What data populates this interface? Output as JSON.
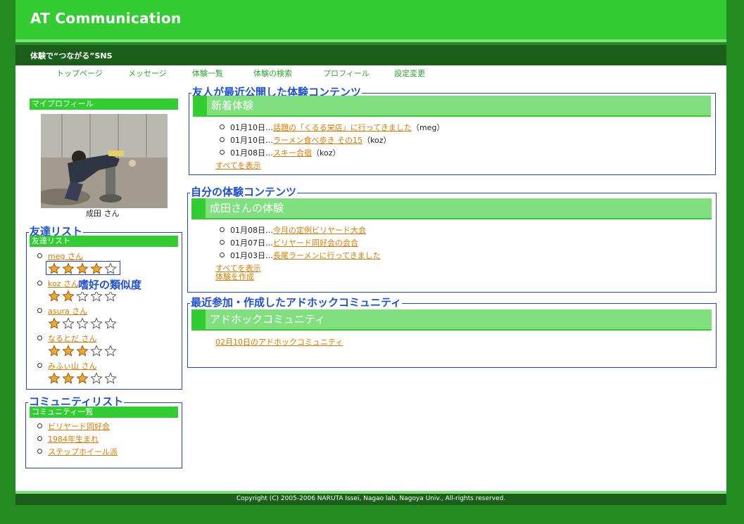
{
  "header": {
    "title": "AT Communication",
    "tagline": "体験で“つながる”SNS"
  },
  "nav": [
    "トップページ",
    "メッセージ",
    "体験一覧",
    "体験の検索",
    "プロフィール",
    "設定変更"
  ],
  "sidebar": {
    "profile": {
      "bar": "マイプロフィール",
      "name": "成田 さん"
    },
    "friends": {
      "legend": "友達リスト",
      "bar": "友達リスト",
      "annotation": "嗜好の類似度",
      "items": [
        {
          "name": "meg さん",
          "rating": 4
        },
        {
          "name": "koz さん",
          "rating": 2
        },
        {
          "name": "asura さん",
          "rating": 1
        },
        {
          "name": "なるとだ さん",
          "rating": 3
        },
        {
          "name": "みふぃ山 さん",
          "rating": 3
        }
      ]
    },
    "communities": {
      "legend": "コミュニティリスト",
      "bar": "コミュニティ一覧",
      "items": [
        "ビリヤード同好会",
        "1984年生まれ",
        "ステップホイール派"
      ]
    }
  },
  "friends_recent": {
    "legend": "友人が最近公開した体験コンテンツ",
    "heading": "新着体験",
    "items": [
      {
        "date": "01月10日…",
        "title": "話題の「くるる栄店」に行ってきました",
        "author": "（meg）"
      },
      {
        "date": "01月10日…",
        "title": "ラーメン食べ歩き その15",
        "author": "（koz）"
      },
      {
        "date": "01月08日…",
        "title": "スキー合宿",
        "author": "（koz）"
      }
    ],
    "show_all": "すべてを表示"
  },
  "my_content": {
    "legend": "自分の体験コンテンツ",
    "heading": "成田さんの体験",
    "items": [
      {
        "date": "01月08日…",
        "title": "今月の定例ビリヤード大会"
      },
      {
        "date": "01月07日…",
        "title": "ビリヤード同好会の会合"
      },
      {
        "date": "01月03日…",
        "title": "長尾ラーメンに行ってきました"
      }
    ],
    "show_all": "すべてを表示",
    "create": "体験を作成"
  },
  "adhoc": {
    "legend": "最近参加・作成したアドホックコミュニティ",
    "heading": "アドホックコミュニティ",
    "link": "02月10日のアドホックコミュニティ"
  },
  "footer": {
    "copyright": "Copyright (C) 2005-2006 NARUTA Issei, Nagao lab, Nagoya Univ., All-rights reserved."
  },
  "colors": {
    "header_green": "#33cc33",
    "dark_green": "#1a5e1a",
    "page_bg": "#228b22",
    "link_orange": "#d97a00",
    "legend_blue": "#1e4fd6"
  }
}
